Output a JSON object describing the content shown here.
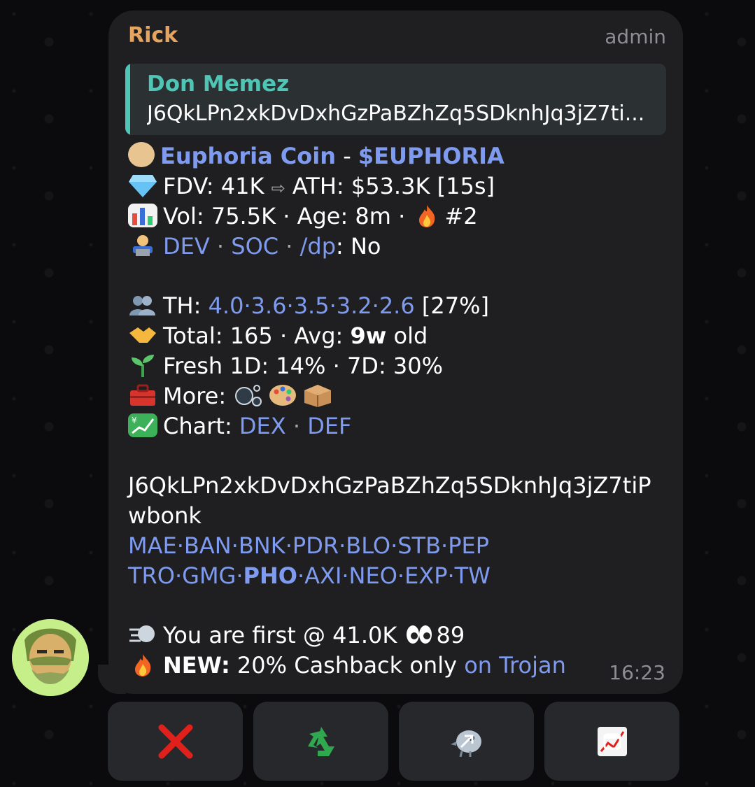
{
  "message": {
    "sender": "Rick",
    "role": "admin",
    "reply": {
      "name": "Don Memez",
      "text": "J6QkLPn2xkDvDxhGzPaBZhZq5SDknhJq3jZ7ti..."
    },
    "token_name": "Euphoria Coin",
    "token_sep": "-",
    "ticker": "$EUPHORIA",
    "fdv_label": "FDV: 41K",
    "arrow": "⇨",
    "ath_label": "ATH: $53.3K [15s]",
    "vol_label": "Vol: 75.5K · Age: 8m ·",
    "rank": "#2",
    "dev": "DEV",
    "dot": "·",
    "soc": "SOC",
    "dp": "/dp",
    "dp_value": ": No",
    "th_label": "TH:",
    "th_values": "4.0·3.6·3.5·3.2·2.6",
    "th_pct": "[27%]",
    "total_label": "Total: 165 · Avg:",
    "avg_value": "9w",
    "avg_suffix": "old",
    "fresh_label": "Fresh 1D: 14% · 7D: 30%",
    "more_label": "More:",
    "chart_label": "Chart:",
    "chart_dex": "DEX",
    "chart_def": "DEF",
    "address_line1": "J6QkLPn2xkDvDxhGzPaBZhZq5SDknhJq3jZ7tiP",
    "address_line2": "wbonk",
    "links_row1": "MAE·BAN·BNK·PDR·BLO·STB·PEP",
    "links_row2_a": "TRO·GMG·",
    "links_row2_b": "PHO",
    "links_row2_c": "·AXI·NEO·EXP·TW",
    "first_label": "You are first @ 41.0K",
    "eyes_count": "89",
    "new_label": "NEW:",
    "cashback_label": "20% Cashback only",
    "trojan_link": "on Trojan",
    "time": "16:23"
  },
  "icons": {
    "token": "dog-face-icon",
    "fdv": "gem-icon",
    "vol": "bar-chart-icon",
    "dev": "technologist-icon",
    "th": "busts-icon",
    "total": "handshake-icon",
    "fresh": "seedling-icon",
    "more": "toolbox-icon",
    "chart": "chart-yen-icon",
    "first": "dash-icon",
    "new": "fire-icon"
  },
  "buttons": [
    {
      "name": "close-button",
      "icon": "red-x-icon"
    },
    {
      "name": "recycle-button",
      "icon": "recycle-icon"
    },
    {
      "name": "bird-button",
      "icon": "bird-icon"
    },
    {
      "name": "chart-button",
      "icon": "chart-increasing-icon"
    }
  ],
  "colors": {
    "sender": "#e5a55f",
    "link": "#7f9bf0",
    "reply_accent": "#4fc5b5",
    "bubble": "#1f1f21",
    "button": "#27282c"
  }
}
